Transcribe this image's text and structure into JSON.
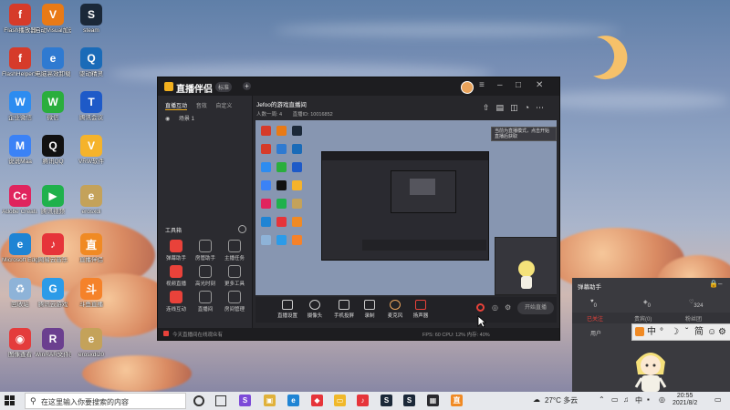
{
  "desktop_icons": [
    {
      "label": "Flash播放器",
      "color": "#d63b2a",
      "glyph": "f"
    },
    {
      "label": "启动Visual加速",
      "color": "#e97a16",
      "glyph": "V"
    },
    {
      "label": "steam",
      "color": "#1b2838",
      "glyph": "S"
    },
    {
      "label": "FlashHelperS...",
      "color": "#d63b2a",
      "glyph": "f"
    },
    {
      "label": "电脑高效卸载",
      "color": "#2f7ad1",
      "glyph": "e"
    },
    {
      "label": "驱动精灵",
      "color": "#1a6bb8",
      "glyph": "Q"
    },
    {
      "label": "企业微信",
      "color": "#2d8cf0",
      "glyph": "W"
    },
    {
      "label": "微信",
      "color": "#2aae3d",
      "glyph": "W"
    },
    {
      "label": "腾讯会议",
      "color": "#1e5ac8",
      "glyph": "T"
    },
    {
      "label": "说说Maa",
      "color": "#3b82f6",
      "glyph": "M"
    },
    {
      "label": "腾讯QQ",
      "color": "#111",
      "glyph": "Q"
    },
    {
      "label": "VRW软件",
      "color": "#f5b32b",
      "glyph": "V"
    },
    {
      "label": "Adobe Creati...",
      "color": "#e0245e",
      "glyph": "Cc"
    },
    {
      "label": "腾讯视频",
      "color": "#1fb14c",
      "glyph": "▶"
    },
    {
      "label": "erosxdi",
      "color": "#c4a25a",
      "glyph": "e"
    },
    {
      "label": "Microsoft Edge",
      "color": "#1f84d4",
      "glyph": "e"
    },
    {
      "label": "网易云音乐",
      "color": "#e6343a",
      "glyph": "♪"
    },
    {
      "label": "直播伴侣",
      "color": "#f08a24",
      "glyph": "直"
    },
    {
      "label": "回收站",
      "color": "#8eb3d8",
      "glyph": "♻"
    },
    {
      "label": "腾讯云游戏",
      "color": "#2c9be8",
      "glyph": "G"
    },
    {
      "label": "斗鱼直播",
      "color": "#f5822a",
      "glyph": "斗"
    },
    {
      "label": "图像查看",
      "color": "#e43c3c",
      "glyph": "◉"
    },
    {
      "label": "WinRAR文件压缩",
      "color": "#6b3f8f",
      "glyph": "R"
    },
    {
      "label": "erosxdi20",
      "color": "#c4a25a",
      "glyph": "e"
    }
  ],
  "app": {
    "name": "直播伴侣",
    "version_badge": "标准",
    "sidebar_tabs": [
      "直播互动",
      "音效",
      "自定义"
    ],
    "scene_label": "场景 1",
    "tools_title": "工具箱",
    "tools": [
      "弹幕助手",
      "房管助手",
      "主播任务",
      "视频直播",
      "高光时刻",
      "更多工具",
      "连线互动",
      "直播间",
      "房间管理"
    ],
    "status_left": "今天直播间在线观众有",
    "room_title": "Jefoo的游戏直播间",
    "room_id": "直播ID: 10016852",
    "room_sub": "人数一周: 4",
    "notice_text": "当前为直播模式，点击开始直播后获取",
    "controls": [
      "直播设置",
      "摄像头",
      "手机投屏",
      "录制",
      "麦克风",
      "扬声器"
    ],
    "start_button": "开始直播",
    "status_right": "FPS: 60  CPU: 12%  内存: 40%"
  },
  "right_panel": {
    "title": "弹幕助手",
    "stats": [
      "0",
      "0",
      "324"
    ],
    "tabs": [
      "已关注",
      "贵宾(0)",
      "粉丝团"
    ],
    "role": "用户"
  },
  "ime": {
    "chars": [
      "中",
      "°",
      "☽",
      "ˇ",
      "简",
      "☺",
      "⚙"
    ]
  },
  "taskbar": {
    "search_placeholder": "在这里输入你要搜索的内容",
    "weather": "27°C 多云",
    "time": "20:55",
    "date": "2021/8/2"
  }
}
